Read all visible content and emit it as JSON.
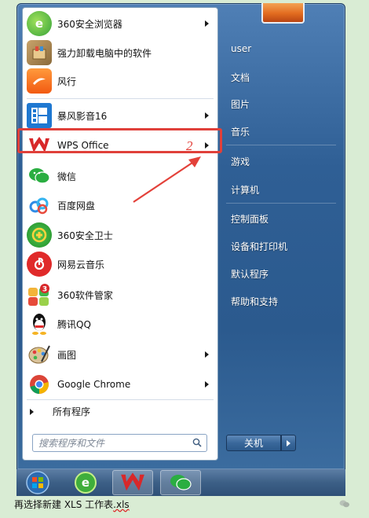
{
  "menu": {
    "programs": [
      {
        "label": "360安全浏览器",
        "icon": "browser-360-icon",
        "has_submenu": true
      },
      {
        "label": "强力卸载电脑中的软件",
        "icon": "uninstall-box-icon",
        "has_submenu": false
      },
      {
        "label": "风行",
        "icon": "funshion-icon",
        "has_submenu": false
      },
      {
        "label": "暴风影音16",
        "icon": "baofeng-icon",
        "has_submenu": true
      },
      {
        "label": "WPS Office",
        "icon": "wps-icon",
        "has_submenu": true
      },
      {
        "label": "微信",
        "icon": "wechat-icon",
        "has_submenu": false
      },
      {
        "label": "百度网盘",
        "icon": "baidu-netdisk-icon",
        "has_submenu": false
      },
      {
        "label": "360安全卫士",
        "icon": "guard-360-icon",
        "has_submenu": false
      },
      {
        "label": "网易云音乐",
        "icon": "netease-music-icon",
        "has_submenu": false
      },
      {
        "label": "360软件管家",
        "icon": "software-manager-360-icon",
        "has_submenu": false
      },
      {
        "label": "腾讯QQ",
        "icon": "qq-penguin-icon",
        "has_submenu": false
      },
      {
        "label": "画图",
        "icon": "paint-palette-icon",
        "has_submenu": true
      },
      {
        "label": "Google Chrome",
        "icon": "chrome-icon",
        "has_submenu": true
      }
    ],
    "all_programs": "所有程序",
    "search_placeholder": "搜索程序和文件",
    "right_items": {
      "user": "user",
      "documents": "文档",
      "pictures": "图片",
      "music": "音乐",
      "games": "游戏",
      "computer": "计算机",
      "control_panel": "控制面板",
      "devices_printers": "设备和打印机",
      "default_programs": "默认程序",
      "help": "帮助和支持"
    },
    "shutdown_label": "关机"
  },
  "annotation": {
    "step_number": "2",
    "highlight_color": "#e0403a"
  },
  "taskbar": {
    "items": [
      "start-orb-icon",
      "browser-360-icon",
      "wps-icon",
      "wechat-icon"
    ]
  },
  "caption": {
    "prefix": "再选择新建  XLS  工作表",
    "suffix": ".xls"
  },
  "colors": {
    "background": "#d9ecd4",
    "menu_blue": "#2f5f95",
    "accent_red": "#e3413a"
  }
}
